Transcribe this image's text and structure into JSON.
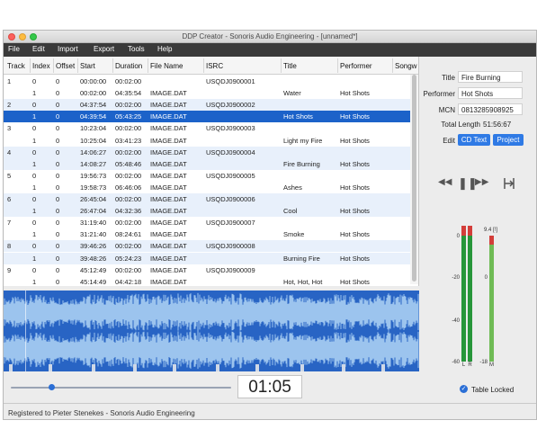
{
  "window": {
    "title": "DDP Creator - Sonoris Audio Engineering - [unnamed*]"
  },
  "menu": [
    "File",
    "Edit",
    "Import",
    "Export",
    "Tools",
    "Help"
  ],
  "table": {
    "columns": [
      "Track",
      "Index",
      "Offset",
      "Start",
      "Duration",
      "File Name",
      "ISRC",
      "Title",
      "Performer",
      "Songw"
    ],
    "rows": [
      {
        "track": "1",
        "index": "0",
        "offset": "0",
        "start": "00:00:00",
        "duration": "00:02:00",
        "file": "",
        "isrc": "USQDJ0900001",
        "title": "",
        "performer": "",
        "style": "normal"
      },
      {
        "track": "",
        "index": "1",
        "offset": "0",
        "start": "00:02:00",
        "duration": "04:35:54",
        "file": "IMAGE.DAT",
        "isrc": "",
        "title": "Water",
        "performer": "Hot Shots",
        "style": "normal"
      },
      {
        "track": "2",
        "index": "0",
        "offset": "0",
        "start": "04:37:54",
        "duration": "00:02:00",
        "file": "IMAGE.DAT",
        "isrc": "USQDJ0900002",
        "title": "",
        "performer": "",
        "style": "alt"
      },
      {
        "track": "",
        "index": "1",
        "offset": "0",
        "start": "04:39:54",
        "duration": "05:43:25",
        "file": "IMAGE.DAT",
        "isrc": "",
        "title": "Hot Shots",
        "performer": "Hot Shots",
        "style": "sel"
      },
      {
        "track": "3",
        "index": "0",
        "offset": "0",
        "start": "10:23:04",
        "duration": "00:02:00",
        "file": "IMAGE.DAT",
        "isrc": "USQDJ0900003",
        "title": "",
        "performer": "",
        "style": "normal"
      },
      {
        "track": "",
        "index": "1",
        "offset": "0",
        "start": "10:25:04",
        "duration": "03:41:23",
        "file": "IMAGE.DAT",
        "isrc": "",
        "title": "Light my Fire",
        "performer": "Hot Shots",
        "style": "normal"
      },
      {
        "track": "4",
        "index": "0",
        "offset": "0",
        "start": "14:06:27",
        "duration": "00:02:00",
        "file": "IMAGE.DAT",
        "isrc": "USQDJ0900004",
        "title": "",
        "performer": "",
        "style": "alt"
      },
      {
        "track": "",
        "index": "1",
        "offset": "0",
        "start": "14:08:27",
        "duration": "05:48:46",
        "file": "IMAGE.DAT",
        "isrc": "",
        "title": "Fire Burning",
        "performer": "Hot Shots",
        "style": "alt"
      },
      {
        "track": "5",
        "index": "0",
        "offset": "0",
        "start": "19:56:73",
        "duration": "00:02:00",
        "file": "IMAGE.DAT",
        "isrc": "USQDJ0900005",
        "title": "",
        "performer": "",
        "style": "normal"
      },
      {
        "track": "",
        "index": "1",
        "offset": "0",
        "start": "19:58:73",
        "duration": "06:46:06",
        "file": "IMAGE.DAT",
        "isrc": "",
        "title": "Ashes",
        "performer": "Hot Shots",
        "style": "normal"
      },
      {
        "track": "6",
        "index": "0",
        "offset": "0",
        "start": "26:45:04",
        "duration": "00:02:00",
        "file": "IMAGE.DAT",
        "isrc": "USQDJ0900006",
        "title": "",
        "performer": "",
        "style": "alt"
      },
      {
        "track": "",
        "index": "1",
        "offset": "0",
        "start": "26:47:04",
        "duration": "04:32:36",
        "file": "IMAGE.DAT",
        "isrc": "",
        "title": "Cool",
        "performer": "Hot Shots",
        "style": "alt"
      },
      {
        "track": "7",
        "index": "0",
        "offset": "0",
        "start": "31:19:40",
        "duration": "00:02:00",
        "file": "IMAGE.DAT",
        "isrc": "USQDJ0900007",
        "title": "",
        "performer": "",
        "style": "normal"
      },
      {
        "track": "",
        "index": "1",
        "offset": "0",
        "start": "31:21:40",
        "duration": "08:24:61",
        "file": "IMAGE.DAT",
        "isrc": "",
        "title": "Smoke",
        "performer": "Hot Shots",
        "style": "normal"
      },
      {
        "track": "8",
        "index": "0",
        "offset": "0",
        "start": "39:46:26",
        "duration": "00:02:00",
        "file": "IMAGE.DAT",
        "isrc": "USQDJ0900008",
        "title": "",
        "performer": "",
        "style": "alt"
      },
      {
        "track": "",
        "index": "1",
        "offset": "0",
        "start": "39:48:26",
        "duration": "05:24:23",
        "file": "IMAGE.DAT",
        "isrc": "",
        "title": "Burning Fire",
        "performer": "Hot Shots",
        "style": "alt"
      },
      {
        "track": "9",
        "index": "0",
        "offset": "0",
        "start": "45:12:49",
        "duration": "00:02:00",
        "file": "IMAGE.DAT",
        "isrc": "USQDJ0900009",
        "title": "",
        "performer": "",
        "style": "normal"
      },
      {
        "track": "",
        "index": "1",
        "offset": "0",
        "start": "45:14:49",
        "duration": "04:42:18",
        "file": "IMAGE.DAT",
        "isrc": "",
        "title": "Hot, Hot, Hot",
        "performer": "Hot Shots",
        "style": "normal"
      }
    ]
  },
  "info": {
    "title_label": "Title",
    "title_value": "Fire Burning",
    "performer_label": "Performer",
    "performer_value": "Hot Shots",
    "mcn_label": "MCN",
    "mcn_value": "0813285908925",
    "length_label": "Total Length",
    "length_value": "51:56:67",
    "edit_label": "Edit",
    "cdtext_button": "CD Text",
    "project_button": "Project"
  },
  "transport": {
    "rewind_icon": "◀◀",
    "pause_icon": "❚❚",
    "forward_icon": "▶▶",
    "loop_icon": "loop-icon"
  },
  "meters": {
    "scale": [
      "0",
      "-20",
      "-40",
      "-60"
    ],
    "scale_right": [
      "9.4 [!]",
      "0",
      "-18"
    ],
    "channel_l": "L",
    "channel_r": "R",
    "channel_m": "M",
    "accent": "#27963a",
    "clip": "#d33e3a"
  },
  "playback": {
    "time": "01:05",
    "position": 0.19
  },
  "table_locked": "Table Locked",
  "status": "Registered to Pieter Stenekes - Sonoris Audio Engineering",
  "colors": {
    "selection": "#1c62c9",
    "waveform_bg": "#2864c4",
    "waveform_wave": "#9cc4ee"
  }
}
